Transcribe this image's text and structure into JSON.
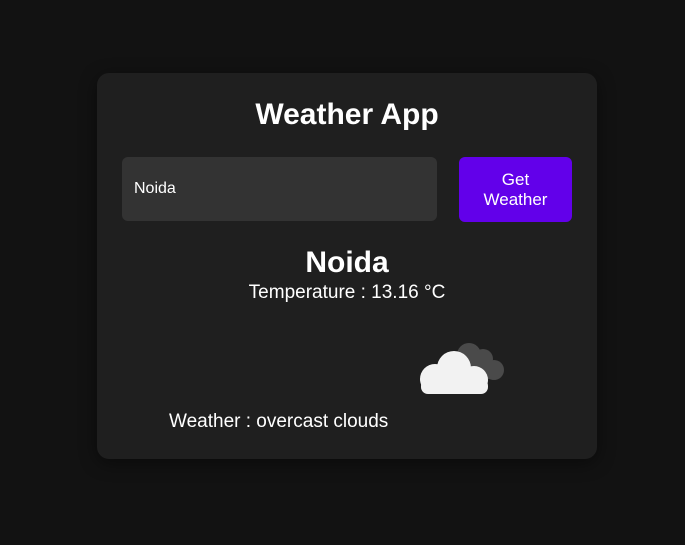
{
  "app": {
    "title": "Weather App"
  },
  "search": {
    "value": "Noida",
    "button_label": "Get Weather"
  },
  "result": {
    "city": "Noida",
    "temperature_text": "Temperature : 13.16 °C",
    "weather_text": "Weather : overcast clouds",
    "icon": "overcast-clouds-icon"
  },
  "colors": {
    "page_bg": "#121212",
    "card_bg": "#1f1f1f",
    "input_bg": "#333333",
    "accent": "#6200ea",
    "text": "#ffffff"
  }
}
